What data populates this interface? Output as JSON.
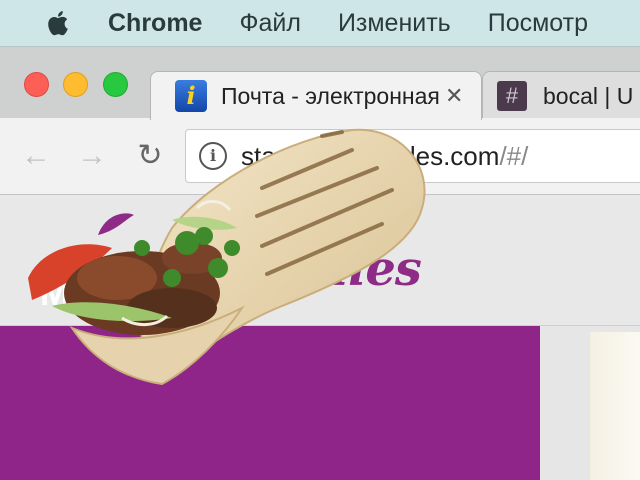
{
  "menubar": {
    "app_name": "Chrome",
    "items": [
      "Файл",
      "Изменить",
      "Посмотр"
    ]
  },
  "tabs": [
    {
      "title": "Почта - электронная",
      "favicon": "info-icon",
      "close": "✕"
    },
    {
      "title": "bocal | U",
      "favicon": "hash-icon"
    }
  ],
  "toolbar": {
    "back": "←",
    "forward": "→",
    "reload": "↻",
    "url_host": "stagin",
    "url_host_end": "ltales.com",
    "url_path": "/#/"
  },
  "page": {
    "logo_text": "ales",
    "panel_text": "M  F"
  },
  "colors": {
    "brand_purple": "#8f2588",
    "menubar": "#cfe6e8"
  }
}
